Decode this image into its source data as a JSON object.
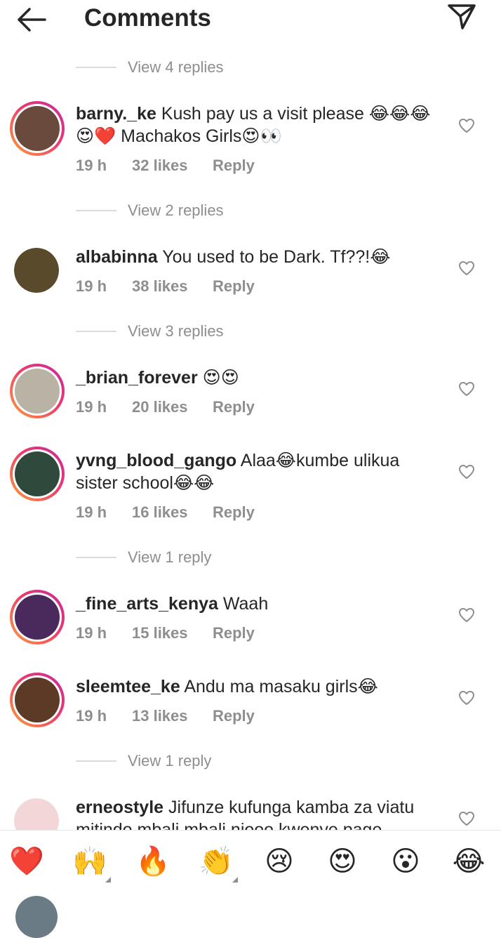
{
  "header": {
    "title": "Comments",
    "back_icon": "arrow-left-icon",
    "send_icon": "paper-plane-icon"
  },
  "comments": [
    {
      "replies_before": "View 4 replies",
      "username": "barny._ke",
      "text": "Kush pay us a visit please 😂😂😂😍❤️ Machakos Girls😍👀",
      "time": "19 h",
      "likes": "32 likes",
      "reply": "Reply",
      "story_ring": true,
      "avatar_color": "#6b4a3e"
    },
    {
      "replies_before": "View 2 replies",
      "username": "albabinna",
      "text": "You used to be Dark. Tf??!😂",
      "time": "19 h",
      "likes": "38 likes",
      "reply": "Reply",
      "story_ring": false,
      "avatar_color": "#5a4a2c"
    },
    {
      "replies_before": "View 3 replies",
      "username": "_brian_forever",
      "text": "😍😍",
      "time": "19 h",
      "likes": "20 likes",
      "reply": "Reply",
      "story_ring": true,
      "avatar_color": "#b9b3a6"
    },
    {
      "username": "yvng_blood_gango",
      "text": "Alaa😂kumbe ulikua sister school😂😂",
      "time": "19 h",
      "likes": "16 likes",
      "reply": "Reply",
      "story_ring": true,
      "avatar_color": "#2f4a3c"
    },
    {
      "replies_before": "View 1 reply",
      "username": "_fine_arts_kenya",
      "text": "Waah",
      "time": "19 h",
      "likes": "15 likes",
      "reply": "Reply",
      "story_ring": true,
      "avatar_color": "#4a2a5c"
    },
    {
      "username": "sleemtee_ke",
      "text": "Andu ma masaku girls😂",
      "time": "19 h",
      "likes": "13 likes",
      "reply": "Reply",
      "story_ring": true,
      "avatar_color": "#5c3a26"
    },
    {
      "replies_before": "View 1 reply",
      "username": "erneostyle",
      "text": "Jifunze kufunga kamba za viatu mitindo mbali mbali njooo kwenye page",
      "story_ring": false,
      "avatar_color": "#f3d6d8"
    }
  ],
  "emoji_bar": {
    "emojis": [
      "❤️",
      "🙌",
      "🔥",
      "👏",
      "😢",
      "😍",
      "😮",
      "😂"
    ],
    "icon_names": [
      "heart-emoji",
      "raising-hands-emoji",
      "fire-emoji",
      "clapping-hands-emoji",
      "crying-face-emoji",
      "heart-eyes-emoji",
      "surprised-face-emoji",
      "tears-of-joy-emoji"
    ]
  },
  "colors": {
    "text": "#262626",
    "secondary": "#8e8e8e",
    "divider": "#dbdbdb"
  }
}
